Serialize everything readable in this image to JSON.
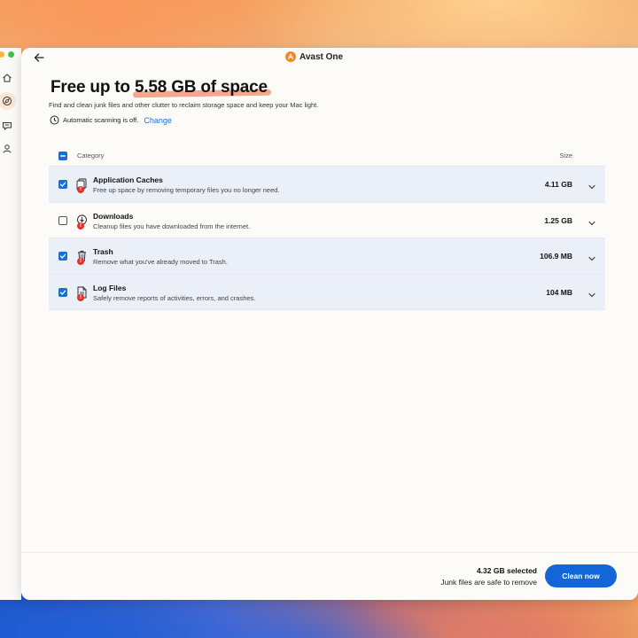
{
  "app": {
    "name": "Avast One"
  },
  "header": {
    "title_prefix": "Free up to",
    "title_highlight": "5.58 GB of space",
    "subtitle": "Find and clean junk files and other clutter to reclaim storage space and keep your Mac light.",
    "scan_status": "Automatic scanning is off.",
    "scan_link": "Change"
  },
  "table": {
    "col_category": "Category",
    "col_size": "Size",
    "rows": [
      {
        "title": "Application Caches",
        "desc": "Free up space by removing temporary files you no longer need.",
        "size": "4.11 GB",
        "checked": true
      },
      {
        "title": "Downloads",
        "desc": "Cleanup files you have downloaded from the internet.",
        "size": "1.25 GB",
        "checked": false
      },
      {
        "title": "Trash",
        "desc": "Remove what you've already moved to Trash.",
        "size": "106.9 MB",
        "checked": true
      },
      {
        "title": "Log Files",
        "desc": "Safely remove reports of activities, errors, and crashes.",
        "size": "104 MB",
        "checked": true
      }
    ]
  },
  "footer": {
    "selected": "4.32 GB selected",
    "note": "Junk files are safe to remove",
    "clean_label": "Clean now"
  },
  "colors": {
    "accent": "#1266d8",
    "highlight": "#f6a58f",
    "badge": "#e0332a",
    "brand": "#f08a24"
  },
  "icons": {
    "sidebar": [
      "home-icon",
      "compass-icon",
      "chat-icon",
      "person-icon"
    ],
    "rows": [
      "cache-icon",
      "download-icon",
      "trash-icon",
      "log-file-icon"
    ]
  }
}
